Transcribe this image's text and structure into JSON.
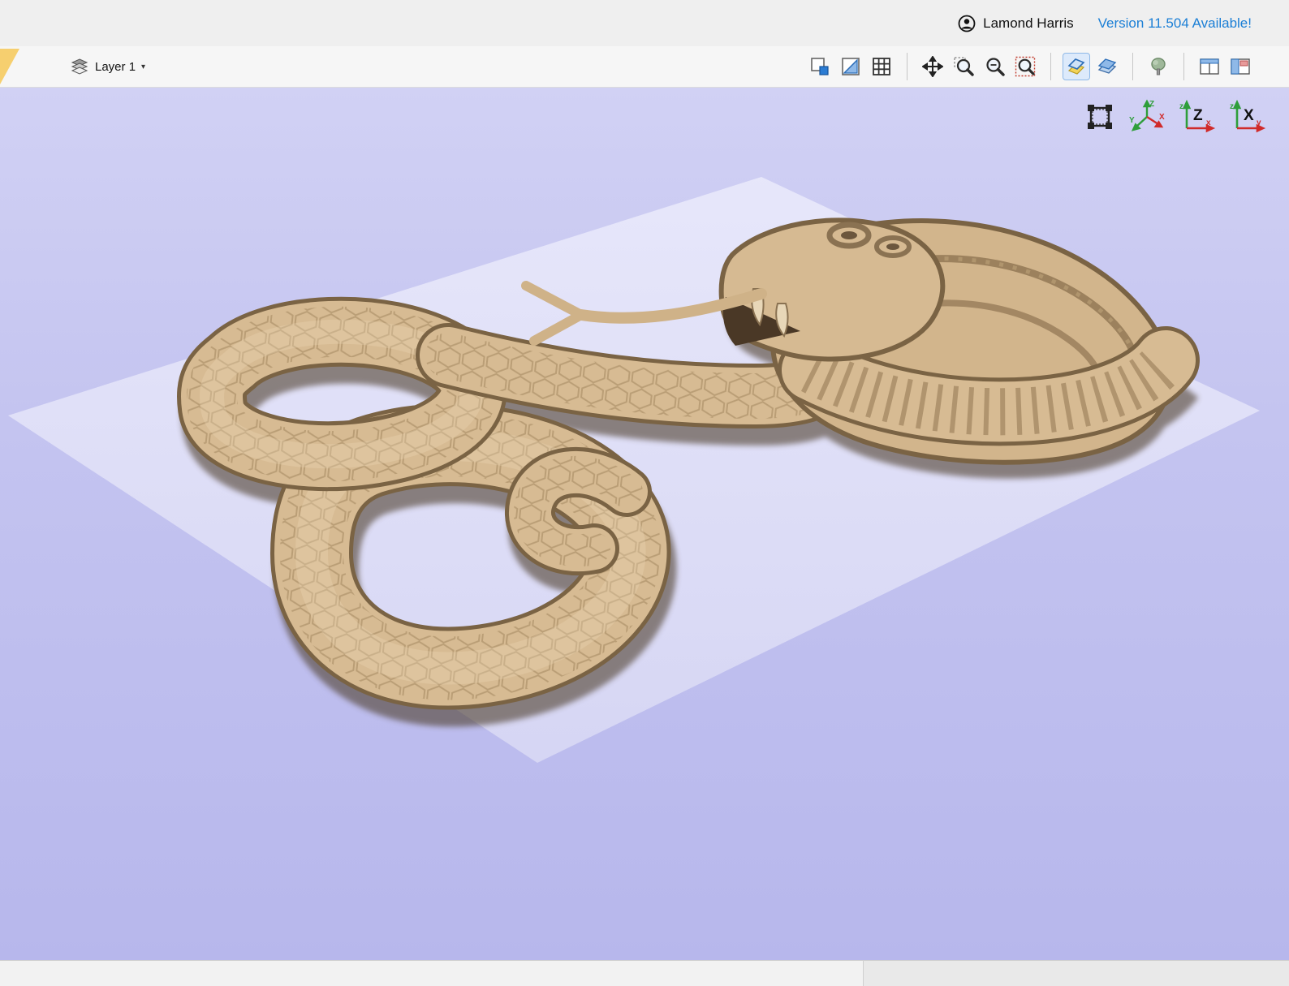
{
  "colors": {
    "accent_blue": "#1b7fd6",
    "viewport_top": "#d1d1f4",
    "viewport_bottom": "#b7b7ec",
    "material_tan": "#d7bb93",
    "model_shadow": "#50402e",
    "material_plane": "#e4e4f9"
  },
  "top_bar": {
    "user_name": "Lamond Harris",
    "version_link": "Version 11.504 Available!"
  },
  "layer_bar": {
    "layer_label": "Layer 1",
    "caret": "▾",
    "icons": [
      "select-objects",
      "snap-options",
      "grid-toggle",
      "pan-view",
      "zoom-box",
      "zoom-interactive",
      "zoom-selected",
      "toggle-2d-3d-view",
      "multi-sided-view",
      "material-preview",
      "tile-windows-2d-3d",
      "tile-windows-vertical"
    ]
  },
  "viewport": {
    "model_name": "cobra-relief-carving",
    "view_controls": [
      "fit-to-material",
      "isometric-view",
      "front-view",
      "side-view"
    ],
    "axis_letters": {
      "X": "X",
      "Y": "Y",
      "Z": "Z",
      "x": "x",
      "y": "y",
      "z": "z"
    }
  }
}
